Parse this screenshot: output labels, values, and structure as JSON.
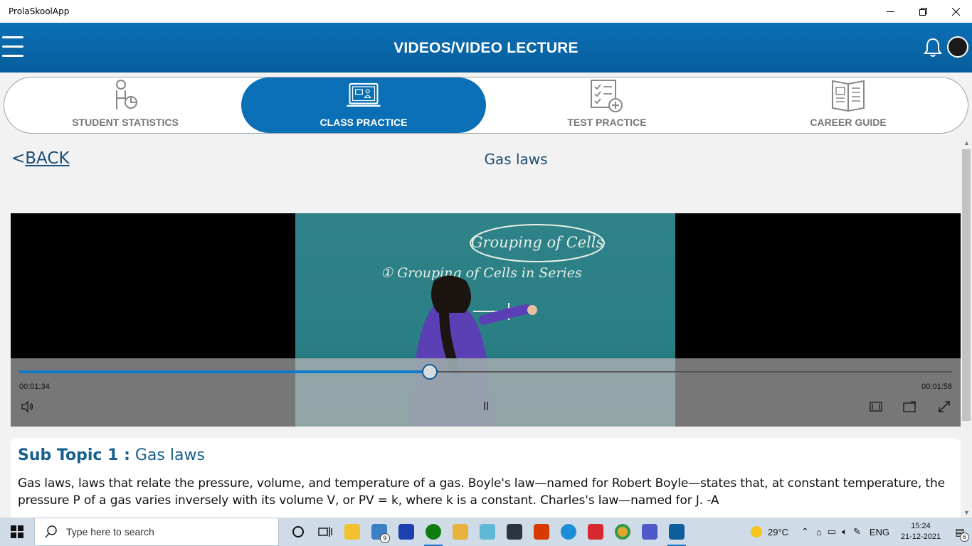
{
  "window": {
    "title": "ProlaSkoolApp"
  },
  "header": {
    "title": "VIDEOS/VIDEO LECTURE"
  },
  "tabs": [
    {
      "label": "STUDENT STATISTICS",
      "icon": "student-statistics-icon",
      "active": false
    },
    {
      "label": "CLASS PRACTICE",
      "icon": "class-practice-icon",
      "active": true
    },
    {
      "label": "TEST PRACTICE",
      "icon": "test-practice-icon",
      "active": false
    },
    {
      "label": "CAREER GUIDE",
      "icon": "career-guide-icon",
      "active": false
    }
  ],
  "nav": {
    "back_arrow": "<",
    "back_label": "BACK",
    "topic_title": "Gas laws"
  },
  "video": {
    "current_time": "00:01:34",
    "total_time": "00:01:58",
    "progress_fraction": 0.44,
    "board_heading": "Grouping of Cells",
    "board_line": "① Grouping of Cells in Series"
  },
  "content": {
    "sub_topic_lead": "Sub Topic 1 :",
    "sub_topic_name": "Gas laws",
    "description": "Gas laws, laws that relate the pressure, volume, and temperature of a gas. Boyle's law—named for Robert Boyle—states that, at constant temperature, the pressure P of a gas varies inversely with its volume V, or PV = k, where k is a constant. Charles's law—named for J. -A"
  },
  "taskbar": {
    "search_placeholder": "Type here to search",
    "mail_badge": "9",
    "temperature": "29°C",
    "language": "ENG",
    "time": "15:24",
    "date": "21-12-2021",
    "notification_count": "6"
  },
  "colors": {
    "header_blue": "#0a6fb4",
    "progress_blue": "#0e78c9",
    "subtopic_blue": "#165f8e"
  }
}
